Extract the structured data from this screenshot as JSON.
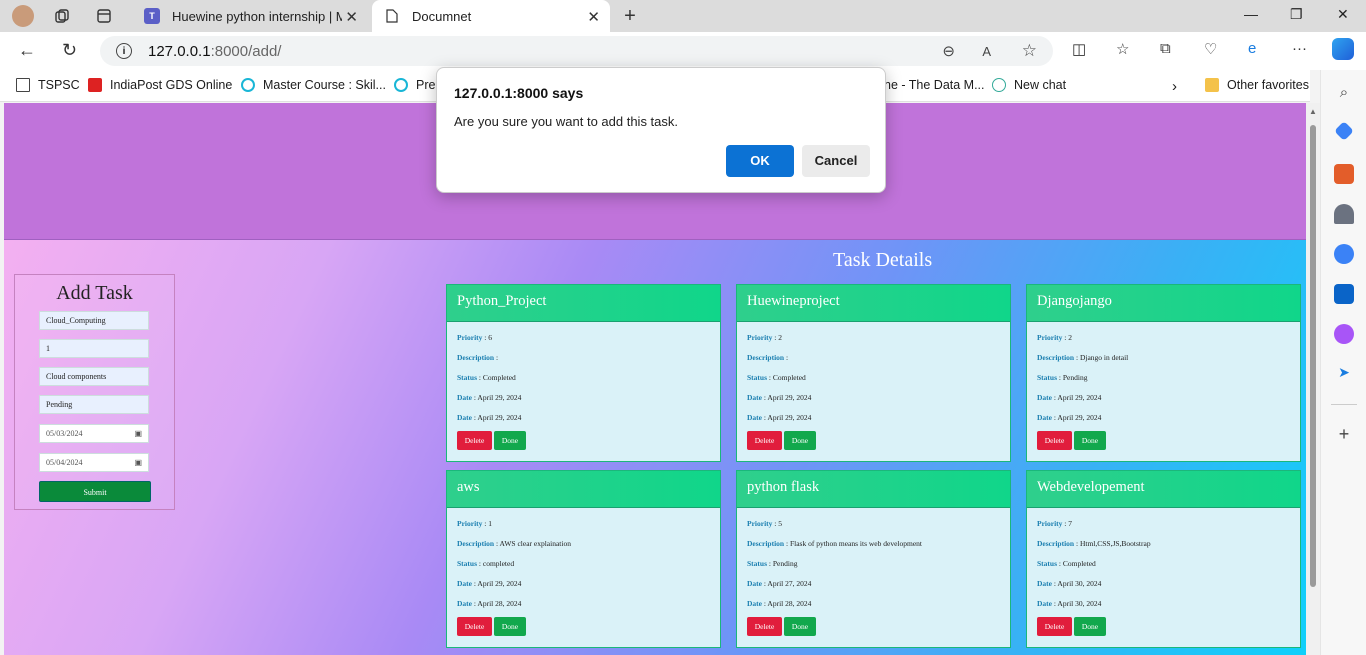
{
  "tabs": [
    {
      "title": "Huewine python internship | Mic"
    },
    {
      "title": "Documnet"
    }
  ],
  "address": {
    "host": "127.0.0.1",
    "path": ":8000/add/"
  },
  "bookmarks": [
    {
      "label": "TSPSC"
    },
    {
      "label": "IndiaPost GDS Online"
    },
    {
      "label": "Master Course : Skil..."
    },
    {
      "label": "Pre"
    },
    {
      "label": "ne - The Data M..."
    },
    {
      "label": "New chat"
    },
    {
      "label": "Other favorites"
    }
  ],
  "dialog": {
    "title": "127.0.0.1:8000 says",
    "message": "Are you sure you want to add this task.",
    "ok_label": "OK",
    "cancel_label": "Cancel"
  },
  "form": {
    "heading": "Add Task",
    "title_value": "Cloud_Computing",
    "priority_value": "1",
    "description_value": "Cloud components",
    "status_value": "Pending",
    "start_date": "05/03/2024",
    "end_date": "05/04/2024",
    "submit_label": "Submit"
  },
  "section_heading": "Task Details",
  "labels": {
    "priority": "Priority",
    "description": "Description",
    "status": "Status",
    "date": "Date",
    "delete": "Delete",
    "done": "Done"
  },
  "tasks": [
    {
      "title": "Python_Project",
      "priority": "6",
      "description": "",
      "status": "Completed",
      "date1": "April 29, 2024",
      "date2": "April 29, 2024"
    },
    {
      "title": "Huewineproject",
      "priority": "2",
      "description": "",
      "status": "Completed",
      "date1": "April 29, 2024",
      "date2": "April 29, 2024"
    },
    {
      "title": "Djangojango",
      "priority": "2",
      "description": "Django in detail",
      "status": "Pending",
      "date1": "April 29, 2024",
      "date2": "April 29, 2024"
    },
    {
      "title": "aws",
      "priority": "1",
      "description": "AWS clear explaination",
      "status": "completed",
      "date1": "April 29, 2024",
      "date2": "April 28, 2024"
    },
    {
      "title": "python flask",
      "priority": "5",
      "description": "Flask of python means its web development",
      "status": "Pending",
      "date1": "April 27, 2024",
      "date2": "April 28, 2024"
    },
    {
      "title": "Webdevelopement",
      "priority": "7",
      "description": "Html,CSS,JS,Bootstrap",
      "status": "Completed",
      "date1": "April 30, 2024",
      "date2": "April 30, 2024"
    }
  ],
  "colors": {
    "banner": "#c073da",
    "ok": "#0c72d4",
    "delete": "#e11d3c",
    "done": "#12a84d",
    "card_header": "#2fcf8c"
  }
}
